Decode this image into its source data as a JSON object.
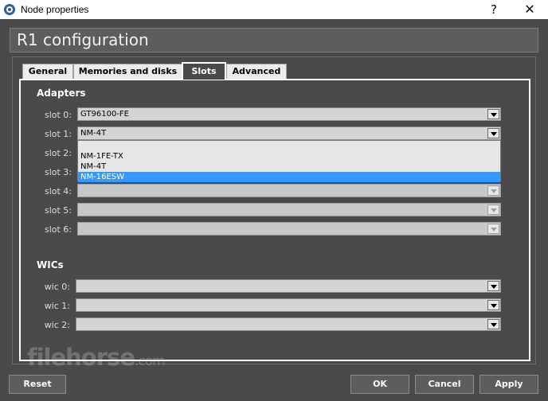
{
  "window": {
    "title": "Node properties",
    "help_glyph": "?",
    "close_glyph": "✕"
  },
  "header": {
    "title": "R1 configuration"
  },
  "tabs": [
    {
      "label": "General",
      "active": false
    },
    {
      "label": "Memories and disks",
      "active": false
    },
    {
      "label": "Slots",
      "active": true
    },
    {
      "label": "Advanced",
      "active": false
    }
  ],
  "adapters": {
    "title": "Adapters",
    "slots": [
      {
        "label": "slot 0:",
        "value": "GT96100-FE",
        "enabled": true
      },
      {
        "label": "slot 1:",
        "value": "NM-4T",
        "enabled": true
      },
      {
        "label": "slot 2:",
        "value": "",
        "enabled": true
      },
      {
        "label": "slot 3:",
        "value": "",
        "enabled": true
      },
      {
        "label": "slot 4:",
        "value": "",
        "enabled": false
      },
      {
        "label": "slot 5:",
        "value": "",
        "enabled": false
      },
      {
        "label": "slot 6:",
        "value": "",
        "enabled": false
      }
    ],
    "open_dropdown": {
      "options": [
        "",
        "NM-1FE-TX",
        "NM-4T",
        "NM-16ESW"
      ],
      "highlighted": "NM-16ESW"
    }
  },
  "wics": {
    "title": "WICs",
    "slots": [
      {
        "label": "wic 0:",
        "value": ""
      },
      {
        "label": "wic 1:",
        "value": ""
      },
      {
        "label": "wic 2:",
        "value": ""
      }
    ]
  },
  "watermark": {
    "text": "filehorse",
    "suffix": ".com"
  },
  "buttons": {
    "reset": "Reset",
    "ok": "OK",
    "cancel": "Cancel",
    "apply": "Apply"
  },
  "colors": {
    "background": "#4a4a4a",
    "highlight": "#3399ff",
    "text": "#ffffff"
  }
}
